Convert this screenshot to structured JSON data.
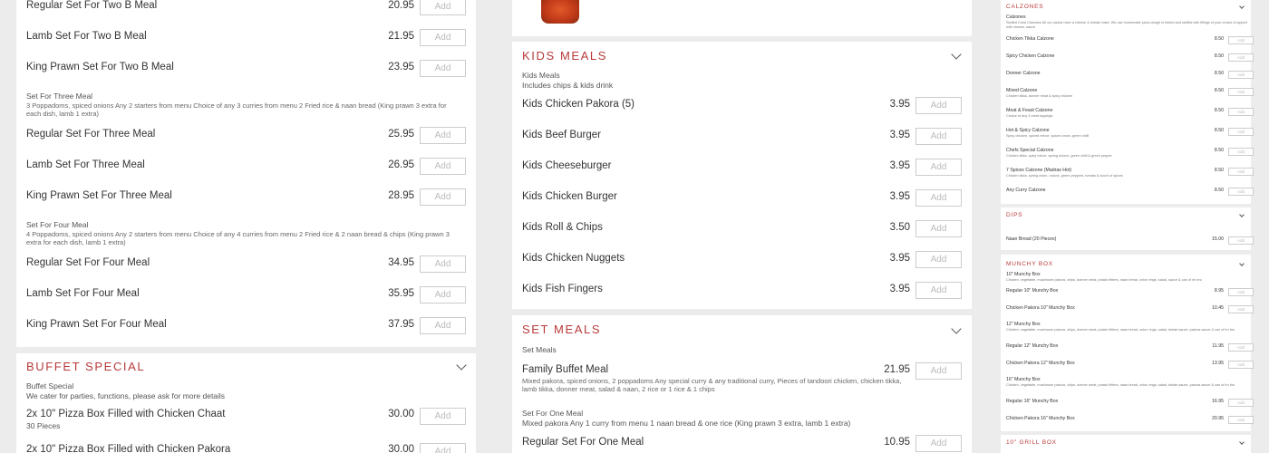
{
  "col1": {
    "top_items": [
      {
        "name": "Regular Set For Two B Meal",
        "price": "20.95"
      },
      {
        "name": "Lamb Set For Two B Meal",
        "price": "21.95"
      },
      {
        "name": "King Prawn Set For Two B Meal",
        "price": "23.95"
      }
    ],
    "three": {
      "sub_title": "Set For Three Meal",
      "sub_desc": "3 Poppadoms, spiced onions Any 2 starters from menu Choice of any 3 curries from menu 2 Fried rice & naan bread (King prawn 3 extra for each dish, lamb 1 extra)",
      "items": [
        {
          "name": "Regular Set For Three Meal",
          "price": "25.95"
        },
        {
          "name": "Lamb Set For Three Meal",
          "price": "26.95"
        },
        {
          "name": "King Prawn Set For Three Meal",
          "price": "28.95"
        }
      ]
    },
    "four": {
      "sub_title": "Set For Four Meal",
      "sub_desc": "4 Poppadoms, spiced onions Any 2 starters from menu Choice of any 4 curries from menu 2 Fried rice & 2 naan bread & chips (King prawn 3 extra for each dish, lamb 1 extra)",
      "items": [
        {
          "name": "Regular Set For Four Meal",
          "price": "34.95"
        },
        {
          "name": "Lamb Set For Four Meal",
          "price": "35.95"
        },
        {
          "name": "King Prawn Set For Four Meal",
          "price": "37.95"
        }
      ]
    },
    "buffet": {
      "title": "BUFFET SPECIAL",
      "sub_title": "Buffet Special",
      "sub_desc": "We cater for parties, functions, please ask for more details",
      "items": [
        {
          "name": "2x 10\" Pizza Box Filled with Chicken Chaat",
          "desc": "30 Pieces",
          "price": "30.00"
        },
        {
          "name": "2x 10\" Pizza Box Filled with Chicken Pakora",
          "price": "30.00"
        }
      ]
    }
  },
  "col2": {
    "kids": {
      "title": "KIDS MEALS",
      "sub_title": "Kids Meals",
      "sub_desc": "Includes chips & kids drink",
      "items": [
        {
          "name": "Kids Chicken Pakora (5)",
          "price": "3.95"
        },
        {
          "name": "Kids Beef Burger",
          "price": "3.95"
        },
        {
          "name": "Kids Cheeseburger",
          "price": "3.95"
        },
        {
          "name": "Kids Chicken Burger",
          "price": "3.95"
        },
        {
          "name": "Kids Roll & Chips",
          "price": "3.50"
        },
        {
          "name": "Kids Chicken Nuggets",
          "price": "3.95"
        },
        {
          "name": "Kids Fish Fingers",
          "price": "3.95"
        }
      ]
    },
    "set": {
      "title": "SET MEALS",
      "sub_title": "Set Meals",
      "family": {
        "name": "Family Buffet Meal",
        "price": "21.95",
        "desc": "Mixed pakora, spiced onions, 2 poppadoms Any special curry & any traditional curry, Pieces of tandoori chicken, chicken tikka, lamb tikka, donner meat, salad & naan, 2 rice or 1 rice & 1 chips"
      },
      "one_sub_title": "Set For One Meal",
      "one_sub_desc": "Mixed pakora Any 1 curry from menu 1 naan bread & one rice (King prawn 3 extra, lamb 1 extra)",
      "regular_one": {
        "name": "Regular Set For One Meal",
        "price": "10.95"
      }
    }
  },
  "col3": {
    "calzones": {
      "title": "CALZONES",
      "sub_title": "Calzones",
      "sub_desc": "Stuffed Crust Calzones All our pizzas have a cheese & tomato base. We use homemade pizza dough in folded and stuffed with fillings of your choice & topped with cheese, sauce",
      "items": [
        {
          "name": "Chicken Tikka Calzone",
          "price": "8.50"
        },
        {
          "name": "Spicy Chicken Calzone",
          "price": "8.50"
        },
        {
          "name": "Donner Calzone",
          "price": "8.50"
        },
        {
          "name": "Mixed Calzone",
          "desc": "Chicken tikka, donner meat & spicy chicken",
          "price": "8.50"
        },
        {
          "name": "Meat & Feast Calzone",
          "desc": "Choice of any 3 meat toppings",
          "price": "8.50"
        },
        {
          "name": "Hot & Spicy Calzone",
          "desc": "Spicy chicken, spiced mince, spiced onion, green chilli",
          "price": "8.50"
        },
        {
          "name": "Chefs Special Calzone",
          "desc": "Chicken tikka, spicy mince, spring onions, green chilli & green pepper",
          "price": "8.50"
        },
        {
          "name": "7 Spices Calzone (Madras Hot)",
          "desc": "Chicken tikka, spring onion, onions, green peppers, tomato & touch of spices",
          "price": "8.50"
        },
        {
          "name": "Any Curry Calzone",
          "price": "8.50"
        }
      ]
    },
    "dips": {
      "title": "DIPS",
      "items": [
        {
          "name": "Naan Bread (20 Pieces)",
          "price": "15.00"
        }
      ]
    },
    "munchy": {
      "title": "MUNCHY BOX",
      "groups": [
        {
          "sub_title": "10\" Munchy Box",
          "sub_desc": "Chicken, vegetable, mushroom pakora, chips, donner meat, potato fritters, naan bread, onion rings, salad, sauce & can of irn bru",
          "items": [
            {
              "name": "Regular 10\" Munchy Box",
              "price": "8.95"
            },
            {
              "name": "Chicken Pakora 10\" Munchy Box",
              "price": "10.45"
            }
          ]
        },
        {
          "sub_title": "12\" Munchy Box",
          "sub_desc": "Chicken, vegetable, mushroom pakora, chips, donner meat, potato fritters, naan bread, onion rings, salad, kebab sauce, pakora sauce & can of irn bru",
          "items": [
            {
              "name": "Regular 12\" Munchy Box",
              "price": "11.95"
            },
            {
              "name": "Chicken Pakora 12\" Munchy Box",
              "price": "13.95"
            }
          ]
        },
        {
          "sub_title": "16\" Munchy Box",
          "sub_desc": "Chicken, vegetable, mushroom pakora, chips, donner meat, potato fritters, naan bread, onion rings, salad, kebab sauce, pakora sauce & can of irn bru",
          "items": [
            {
              "name": "Regular 16\" Munchy Box",
              "price": "16.95"
            },
            {
              "name": "Chicken Pakora 16\" Munchy Box",
              "price": "20.95"
            }
          ]
        }
      ]
    },
    "grill": {
      "title": "10\" GRILL BOX"
    }
  },
  "ui": {
    "add_label": "Add"
  },
  "colors": {
    "accent": "#b83a3a",
    "background": "#ececec",
    "panel": "#ffffff"
  }
}
